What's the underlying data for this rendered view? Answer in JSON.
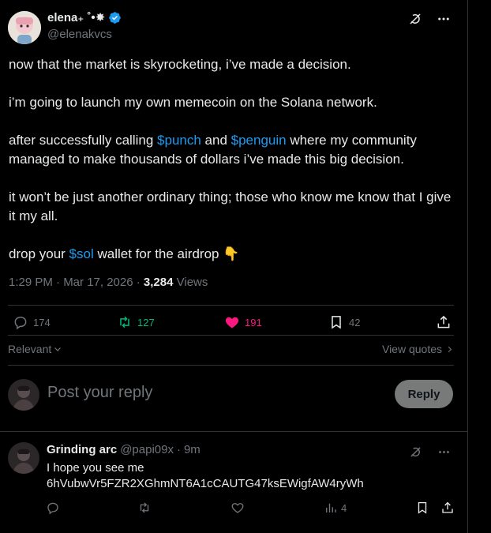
{
  "colors": {
    "accent": "#1d9bf0",
    "retweet": "#00ba7c",
    "like": "#f91880",
    "muted": "#71767b"
  },
  "tweet": {
    "display_name": "elena₊ ˚•✸",
    "handle": "@elenakvcs",
    "paragraphs": {
      "p1": "now that the market is skyrocketing, i’ve made a decision.",
      "p2": "i’m going to launch my own memecoin on the Solana network.",
      "p3_a": "after successfully calling ",
      "p3_link1": "$punch",
      "p3_b": " and ",
      "p3_link2": "$penguin",
      "p3_c": " where my community managed to make thousands of dollars i’ve made this big decision.",
      "p4": "it won’t be just another ordinary thing; those who know me know that I give it my all.",
      "p5_a": "drop your ",
      "p5_link": "$sol",
      "p5_b": " wallet for the airdrop ",
      "p5_emoji": "👇"
    },
    "time": "1:29 PM · Mar 17, 2026 · ",
    "views_count": "3,284",
    "views_label": " Views",
    "stats": {
      "replies": "174",
      "reposts": "127",
      "likes": "191",
      "bookmarks": "42"
    }
  },
  "sort": {
    "relevant": "Relevant",
    "view_quotes": "View quotes"
  },
  "composer": {
    "placeholder": "Post your reply",
    "reply_button": "Reply"
  },
  "reply": {
    "name": "Grinding arc",
    "handle": "@papi09x",
    "dot": "·",
    "time": "9m",
    "line1": "I hope you see me",
    "line2": "6hVubwVr5FZR2XGhmNT6A1cCAUTG47ksEWigfAW4ryWh",
    "views": "4"
  },
  "icons": [
    "grok-icon",
    "more-icon",
    "verified-badge-icon",
    "reply-icon",
    "repost-icon",
    "like-icon",
    "bookmark-icon",
    "share-icon",
    "chevron-down-icon",
    "chevron-right-icon",
    "views-icon"
  ]
}
